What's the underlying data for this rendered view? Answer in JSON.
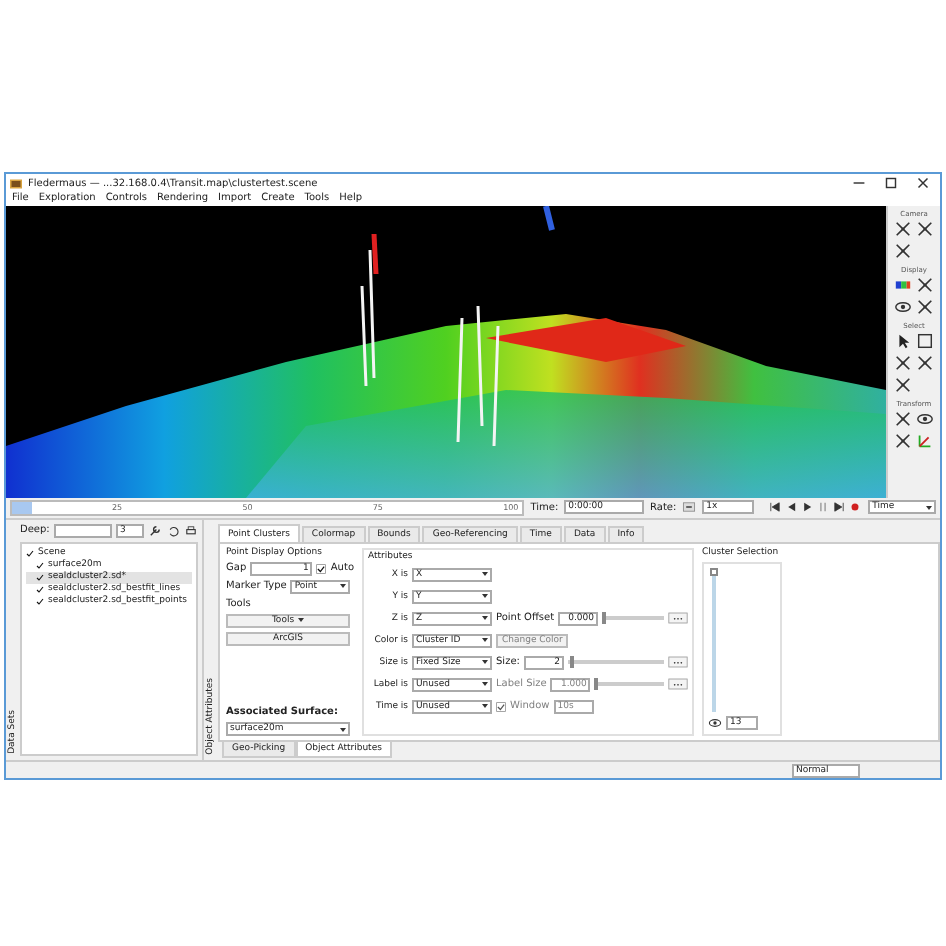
{
  "window": {
    "title": "Fledermaus — ...32.168.0.4\\Transit.map\\clustertest.scene"
  },
  "menu": [
    "File",
    "Exploration",
    "Controls",
    "Rendering",
    "Import",
    "Create",
    "Tools",
    "Help"
  ],
  "toolbar": {
    "groups": [
      {
        "title": "Camera"
      },
      {
        "title": "Display"
      },
      {
        "title": "Select"
      },
      {
        "title": "Transform"
      }
    ]
  },
  "timeline": {
    "level": 0,
    "ticks": [
      "25",
      "50",
      "75",
      "100"
    ],
    "time_label": "Time:",
    "time": "0:00:00",
    "rate_label": "Rate:",
    "rate": "1x",
    "mode": "Time"
  },
  "datasets": {
    "side_label": "Data Sets",
    "search_label": "Deep:",
    "spin": "3",
    "tree": [
      {
        "label": "Scene",
        "checked": true,
        "selected": false,
        "children": [
          {
            "label": "surface20m",
            "checked": true,
            "selected": false
          },
          {
            "label": "sealdcluster2.sd*",
            "checked": true,
            "selected": true
          },
          {
            "label": "sealdcluster2.sd_bestfit_lines",
            "checked": true,
            "selected": false
          },
          {
            "label": "sealdcluster2.sd_bestfit_points",
            "checked": true,
            "selected": false
          }
        ]
      }
    ]
  },
  "attributes": {
    "side_label": "Object Attributes",
    "tabs": [
      {
        "label": "Point Clusters",
        "selected": true
      },
      {
        "label": "Colormap",
        "selected": false
      },
      {
        "label": "Bounds",
        "selected": false
      },
      {
        "label": "Geo-Referencing",
        "selected": false
      },
      {
        "label": "Time",
        "selected": false
      },
      {
        "label": "Data",
        "selected": false
      },
      {
        "label": "Info",
        "selected": false
      }
    ],
    "display_options": {
      "title": "Point Display Options",
      "gap_label": "Gap",
      "gap": "1",
      "auto": {
        "label": "Auto",
        "checked": true
      },
      "marker_label": "Marker Type",
      "marker": "Point",
      "tools_label": "Tools",
      "tools_button": "Tools",
      "arcgis_button": "ArcGIS",
      "surface_label": "Associated Surface:",
      "surface": "surface20m"
    },
    "attr_title": "Attributes",
    "rows": [
      {
        "label": "X is",
        "value": "X"
      },
      {
        "label": "Y is",
        "value": "Y"
      },
      {
        "label": "Z is",
        "value": "Z",
        "extra": {
          "kind": "slider",
          "label": "Point Offset",
          "value": "0.000",
          "level": 0,
          "disabled": false
        }
      },
      {
        "label": "Color is",
        "value": "Cluster ID",
        "extra": {
          "kind": "button",
          "label": "Change Color",
          "disabled": true
        }
      },
      {
        "label": "Size is",
        "value": "Fixed Size",
        "extra": {
          "kind": "slider",
          "label": "Size:",
          "value": "2",
          "level": 0.03,
          "disabled": false
        }
      },
      {
        "label": "Label is",
        "value": "Unused",
        "extra": {
          "kind": "slider",
          "label": "Label Size",
          "value": "1.000",
          "level": 0,
          "disabled": true
        }
      },
      {
        "label": "Time is",
        "value": "Unused",
        "extra": {
          "kind": "check",
          "label": "Window",
          "checked": true,
          "disabled": true,
          "value": "10s"
        }
      }
    ],
    "cluster": {
      "title": "Cluster Selection",
      "level": 1,
      "value": "13"
    },
    "bottom_tabs": [
      {
        "label": "Geo-Picking",
        "selected": false
      },
      {
        "label": "Object Attributes",
        "selected": true
      }
    ]
  },
  "status_bar": {
    "mode": "Normal"
  }
}
